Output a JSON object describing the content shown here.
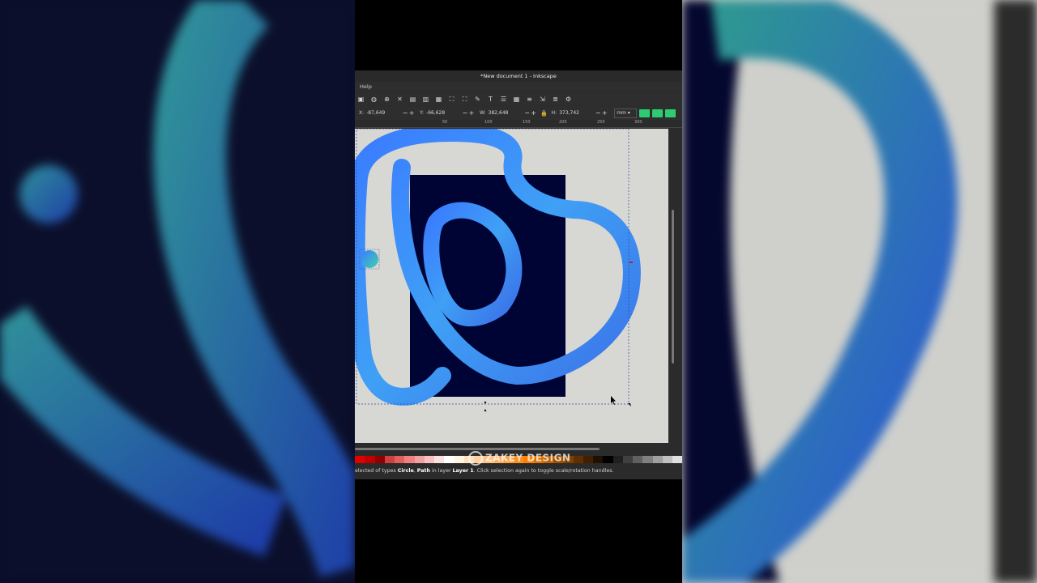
{
  "window": {
    "title": "*New document 1 - Inkscape"
  },
  "menu": {
    "help_label": "Help"
  },
  "toolbar": {
    "icons": [
      "select-all-icon",
      "zoom-drawing-icon",
      "zoom-selection-icon",
      "node-tool-icon",
      "duplicate-icon",
      "clone-icon",
      "unlink-clone-icon",
      "group-icon",
      "ungroup-icon",
      "fill-stroke-icon",
      "text-icon",
      "layers-icon",
      "xml-editor-icon",
      "align-icon",
      "transform-icon",
      "objects-icon",
      "preferences-icon"
    ],
    "glyphs": [
      "▣",
      "◍",
      "⊕",
      "✕",
      "▤",
      "▥",
      "▦",
      "⛶",
      "⛶",
      "✎",
      "T",
      "☰",
      "▦",
      "≡",
      "⇲",
      "≣",
      "⚙"
    ]
  },
  "coords": {
    "x_label": "X:",
    "x_value": "-87,649",
    "y_label": "Y:",
    "y_value": "-66,628",
    "w_label": "W:",
    "w_value": "382,648",
    "h_label": "H:",
    "h_value": "373,742",
    "minus": "−",
    "plus": "+",
    "lock_glyph": "🔒",
    "unit": "mm ▾"
  },
  "ruler": {
    "ticks": [
      "50",
      "100",
      "150",
      "200",
      "250",
      "300"
    ]
  },
  "status": {
    "prefix": "elected of types ",
    "type1": "Circle",
    "sep": ", ",
    "type2": "Path",
    "mid": " in layer ",
    "layer": "Layer 1",
    "suffix": ". Click selection again to toggle scale/rotation handles."
  },
  "watermark": {
    "text": "ZAKEY DESIGN"
  },
  "palette": [
    "#e00000",
    "#c00000",
    "#900000",
    "#d04040",
    "#e06060",
    "#f08080",
    "#f0a0a0",
    "#f8c0c0",
    "#fbe0e0",
    "#ffffff",
    "#fff5e0",
    "#ffe0c0",
    "#ffd0a0",
    "#ffc080",
    "#ffb060",
    "#ffa040",
    "#ff9020",
    "#ff8000",
    "#e07000",
    "#c06000",
    "#a05000",
    "#804000",
    "#603000",
    "#402000",
    "#201000",
    "#000000",
    "#202020",
    "#404040",
    "#606060",
    "#808080",
    "#a0a0a0",
    "#c0c0c0",
    "#e0e0e0"
  ],
  "colors": {
    "accent_green": "#2ecc71",
    "page_fill": "#000435",
    "stroke_blue": "#3a7bff",
    "stroke_cyan": "#40c8e0"
  }
}
